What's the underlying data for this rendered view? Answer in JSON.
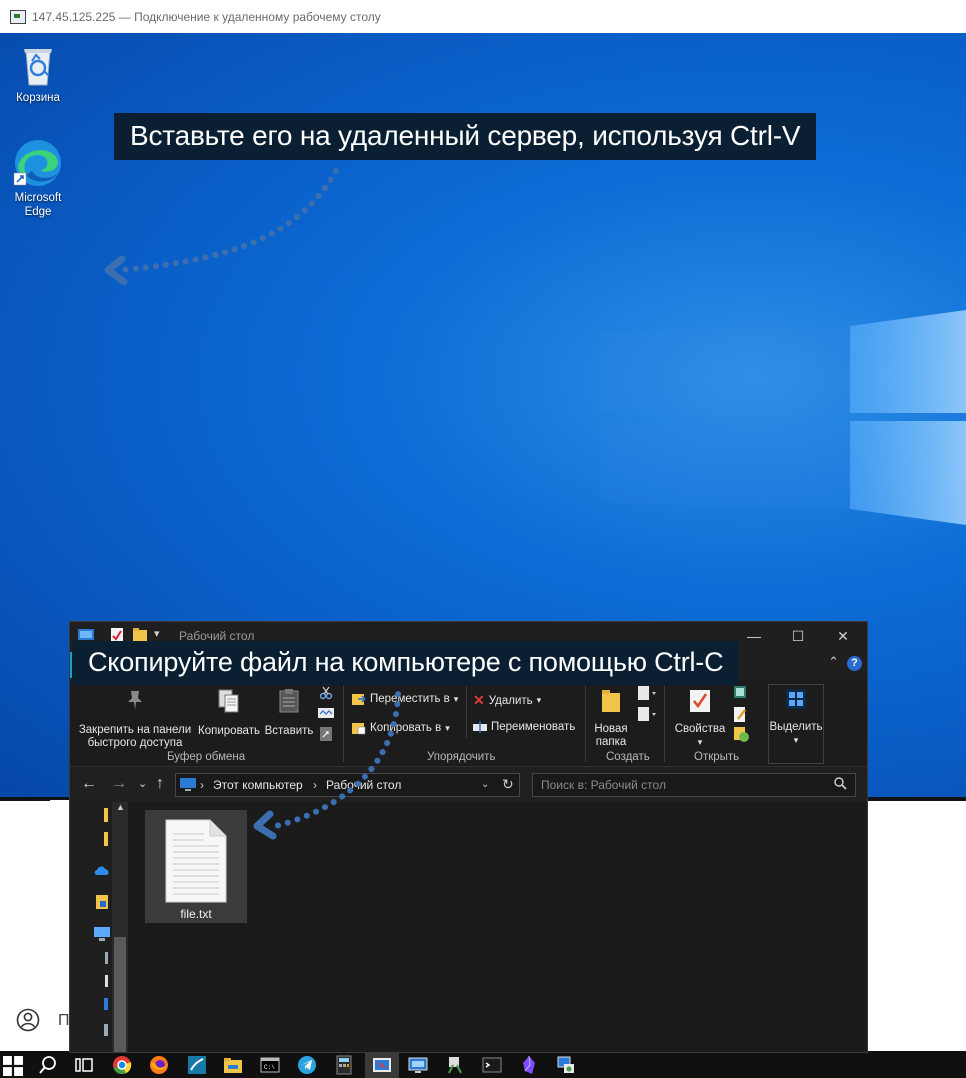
{
  "rdp": {
    "title": "147.45.125.225 — Подключение к удаленному рабочему столу"
  },
  "desktop": {
    "icons": [
      {
        "label": "Корзина"
      },
      {
        "label": "Microsoft Edge"
      }
    ],
    "callout_top": "Вставьте его на удаленный сервер, используя Ctrl-V",
    "callout_bottom": "Скопируйте файл на компьютере с помощью Ctrl-C"
  },
  "explorer": {
    "title": "Рабочий стол",
    "ribbon": {
      "pin": "Закрепить на панели быстрого доступа",
      "copy": "Копировать",
      "paste": "Вставить",
      "group_clipboard": "Буфер обмена",
      "move_to": "Переместить в",
      "copy_to": "Копировать в",
      "delete": "Удалить",
      "rename": "Переименовать",
      "group_organize": "Упорядочить",
      "new_folder": "Новая папка",
      "group_create": "Создать",
      "properties": "Свойства",
      "group_open": "Открыть",
      "select": "Выделить"
    },
    "address": {
      "this_pc": "Этот компьютер",
      "desktop": "Рабочий стол",
      "search_placeholder": "Поиск в: Рабочий стол"
    },
    "files": [
      {
        "name": "file.txt"
      }
    ]
  },
  "local": {
    "user_partial": "П"
  },
  "colors": {
    "desktop_blue": "#0a5ec7",
    "callout_bg": "#0b1f33",
    "arrow_dots": "#3b6fb0",
    "explorer_bg": "#202020"
  },
  "icons": [
    "recycle-bin-icon",
    "edge-icon",
    "windows-start-icon",
    "search-icon",
    "task-view-icon",
    "chrome-icon",
    "firefox-icon",
    "wireshark-icon",
    "folder-icon",
    "cmd-icon",
    "telegram-icon",
    "calculator-icon",
    "snipping-tool-icon",
    "rdp-icon",
    "terminal-icon",
    "obsidian-icon"
  ]
}
